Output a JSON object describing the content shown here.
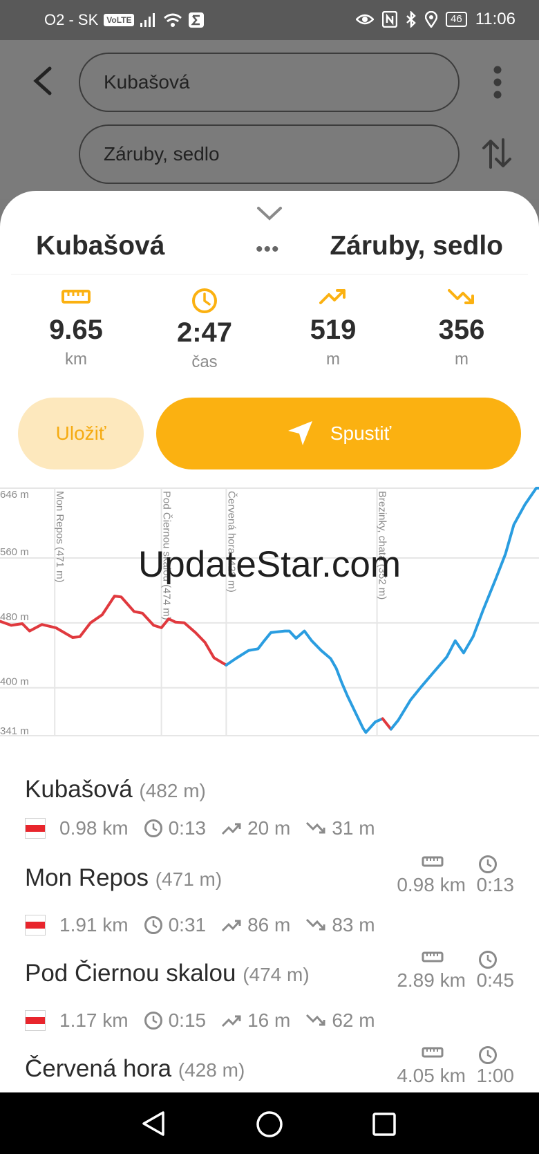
{
  "status_bar": {
    "carrier": "O2 - SK",
    "volte": "VoLTE",
    "battery": "46",
    "time": "11:06"
  },
  "search": {
    "from": "Kubašová",
    "to": "Záruby, sedlo"
  },
  "route": {
    "from": "Kubašová",
    "to": "Záruby, sedlo",
    "dots": "•••"
  },
  "stats": [
    {
      "icon": "ruler-icon",
      "value": "9.65",
      "unit": "km"
    },
    {
      "icon": "clock-icon",
      "value": "2:47",
      "unit": "čas"
    },
    {
      "icon": "ascent-icon",
      "value": "519",
      "unit": "m"
    },
    {
      "icon": "descent-icon",
      "value": "356",
      "unit": "m"
    }
  ],
  "buttons": {
    "save": "Uložiť",
    "start": "Spustiť"
  },
  "watermark": "UpdateStar.com",
  "colors": {
    "accent": "#fbb111",
    "accent_light": "#fde8bd",
    "trail_red": "#e0393e",
    "trail_blue": "#2a9de0"
  },
  "chart_data": {
    "type": "line",
    "y_ticks": [
      "646 m",
      "560 m",
      "480 m",
      "400 m",
      "341 m"
    ],
    "ylim": [
      341,
      646
    ],
    "xlim": [
      0,
      9.65
    ],
    "waypoints": [
      {
        "label": "Mon Repos (471 m)",
        "x": 0.98
      },
      {
        "label": "Pod Čiernou skalou (474 m)",
        "x": 2.89
      },
      {
        "label": "Červená hora (428 m)",
        "x": 4.05
      },
      {
        "label": "Brezinky, chata (352 m)",
        "x": 6.75
      }
    ],
    "series": [
      {
        "color": "#e0393e",
        "points": [
          [
            0,
            482
          ],
          [
            0.2,
            477
          ],
          [
            0.4,
            479
          ],
          [
            0.53,
            470
          ],
          [
            0.75,
            478
          ],
          [
            1.0,
            474
          ],
          [
            1.3,
            462
          ],
          [
            1.43,
            463
          ],
          [
            1.62,
            480
          ],
          [
            1.83,
            490
          ],
          [
            2.05,
            513
          ],
          [
            2.17,
            512
          ],
          [
            2.4,
            494
          ],
          [
            2.55,
            492
          ],
          [
            2.75,
            477
          ],
          [
            2.89,
            474
          ],
          [
            3.02,
            485
          ],
          [
            3.14,
            481
          ],
          [
            3.3,
            480
          ],
          [
            3.5,
            468
          ],
          [
            3.67,
            456
          ],
          [
            3.83,
            437
          ],
          [
            4.05,
            428
          ]
        ]
      },
      {
        "color": "#2a9de0",
        "points": [
          [
            4.05,
            428
          ],
          [
            4.22,
            436
          ],
          [
            4.45,
            446
          ],
          [
            4.62,
            448
          ],
          [
            4.72,
            457
          ],
          [
            4.85,
            468
          ],
          [
            5.1,
            470
          ],
          [
            5.18,
            470
          ],
          [
            5.3,
            461
          ],
          [
            5.45,
            470
          ],
          [
            5.58,
            458
          ],
          [
            5.75,
            446
          ],
          [
            5.92,
            436
          ],
          [
            6.02,
            424
          ],
          [
            6.12,
            406
          ],
          [
            6.22,
            390
          ],
          [
            6.36,
            370
          ],
          [
            6.5,
            350
          ],
          [
            6.55,
            345
          ],
          [
            6.72,
            358
          ],
          [
            6.85,
            362
          ]
        ]
      },
      {
        "color": "#e0393e",
        "points": [
          [
            6.85,
            362
          ],
          [
            7.0,
            349
          ]
        ]
      },
      {
        "color": "#2a9de0",
        "points": [
          [
            7.0,
            349
          ],
          [
            7.13,
            360
          ],
          [
            7.35,
            385
          ],
          [
            7.55,
            402
          ],
          [
            7.75,
            418
          ],
          [
            8.0,
            438
          ],
          [
            8.15,
            458
          ],
          [
            8.3,
            443
          ],
          [
            8.47,
            463
          ],
          [
            8.65,
            496
          ],
          [
            8.88,
            535
          ],
          [
            9.05,
            565
          ],
          [
            9.2,
            601
          ],
          [
            9.4,
            626
          ],
          [
            9.6,
            646
          ],
          [
            9.65,
            646
          ]
        ]
      }
    ]
  },
  "legs": [
    {
      "name": "Kubašová",
      "altitude": "(482 m)",
      "distance": "0.98 km",
      "time": "0:13",
      "ascent": "20 m",
      "descent": "31 m"
    },
    {
      "name": "Mon Repos",
      "altitude": "(471 m)",
      "cum_distance": "0.98 km",
      "cum_time": "0:13",
      "distance": "1.91 km",
      "time": "0:31",
      "ascent": "86 m",
      "descent": "83 m"
    },
    {
      "name": "Pod Čiernou skalou",
      "altitude": "(474 m)",
      "cum_distance": "2.89 km",
      "cum_time": "0:45",
      "distance": "1.17 km",
      "time": "0:15",
      "ascent": "16 m",
      "descent": "62 m"
    },
    {
      "name": "Červená hora",
      "altitude": "(428 m)",
      "cum_distance": "4.05 km",
      "cum_time": "1:00"
    }
  ]
}
